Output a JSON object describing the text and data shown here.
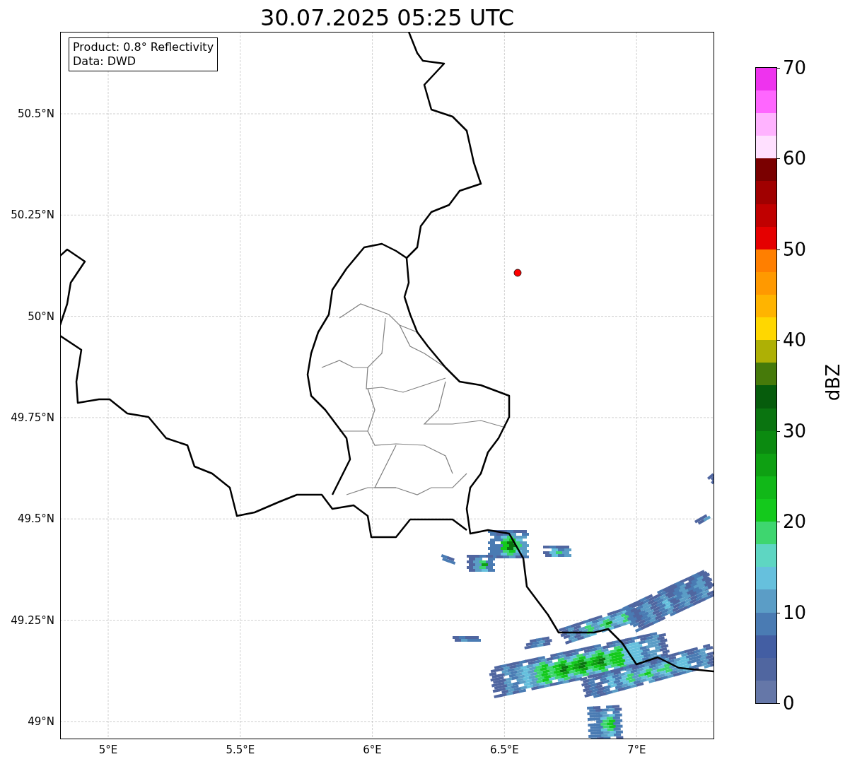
{
  "title": "30.07.2025 05:25 UTC",
  "info_box": {
    "lines": [
      "Product: 0.8° Reflectivity",
      "Data: DWD"
    ]
  },
  "lat_ticks": [
    "50.5°N",
    "50.25°N",
    "50°N",
    "49.75°N",
    "49.5°N",
    "49.25°N",
    "49°N"
  ],
  "lon_ticks": [
    "5°E",
    "5.5°E",
    "6°E",
    "6.5°E",
    "7°E"
  ],
  "colorbar": {
    "label": "dBZ",
    "ticks": [
      "70",
      "60",
      "50",
      "40",
      "30",
      "20",
      "10",
      "0"
    ],
    "bands": [
      {
        "color": "#6577a8"
      },
      {
        "color": "#5066a0"
      },
      {
        "color": "#435ea3"
      },
      {
        "color": "#4a7bb3"
      },
      {
        "color": "#5b9dc6"
      },
      {
        "color": "#66c0dd"
      },
      {
        "color": "#5ed6c2"
      },
      {
        "color": "#3ed66f"
      },
      {
        "color": "#14c91c"
      },
      {
        "color": "#11b818"
      },
      {
        "color": "#0ea012"
      },
      {
        "color": "#0b8a10"
      },
      {
        "color": "#0a7410"
      },
      {
        "color": "#065c0c"
      },
      {
        "color": "#467a0a"
      },
      {
        "color": "#aeb005"
      },
      {
        "color": "#ffd700"
      },
      {
        "color": "#ffb400"
      },
      {
        "color": "#ff9900"
      },
      {
        "color": "#ff7f00"
      },
      {
        "color": "#e50000"
      },
      {
        "color": "#c00000"
      },
      {
        "color": "#a00000"
      },
      {
        "color": "#7a0000"
      },
      {
        "color": "#ffe0ff"
      },
      {
        "color": "#ffb3ff"
      },
      {
        "color": "#ff66ff"
      },
      {
        "color": "#ee33ee"
      }
    ]
  }
}
